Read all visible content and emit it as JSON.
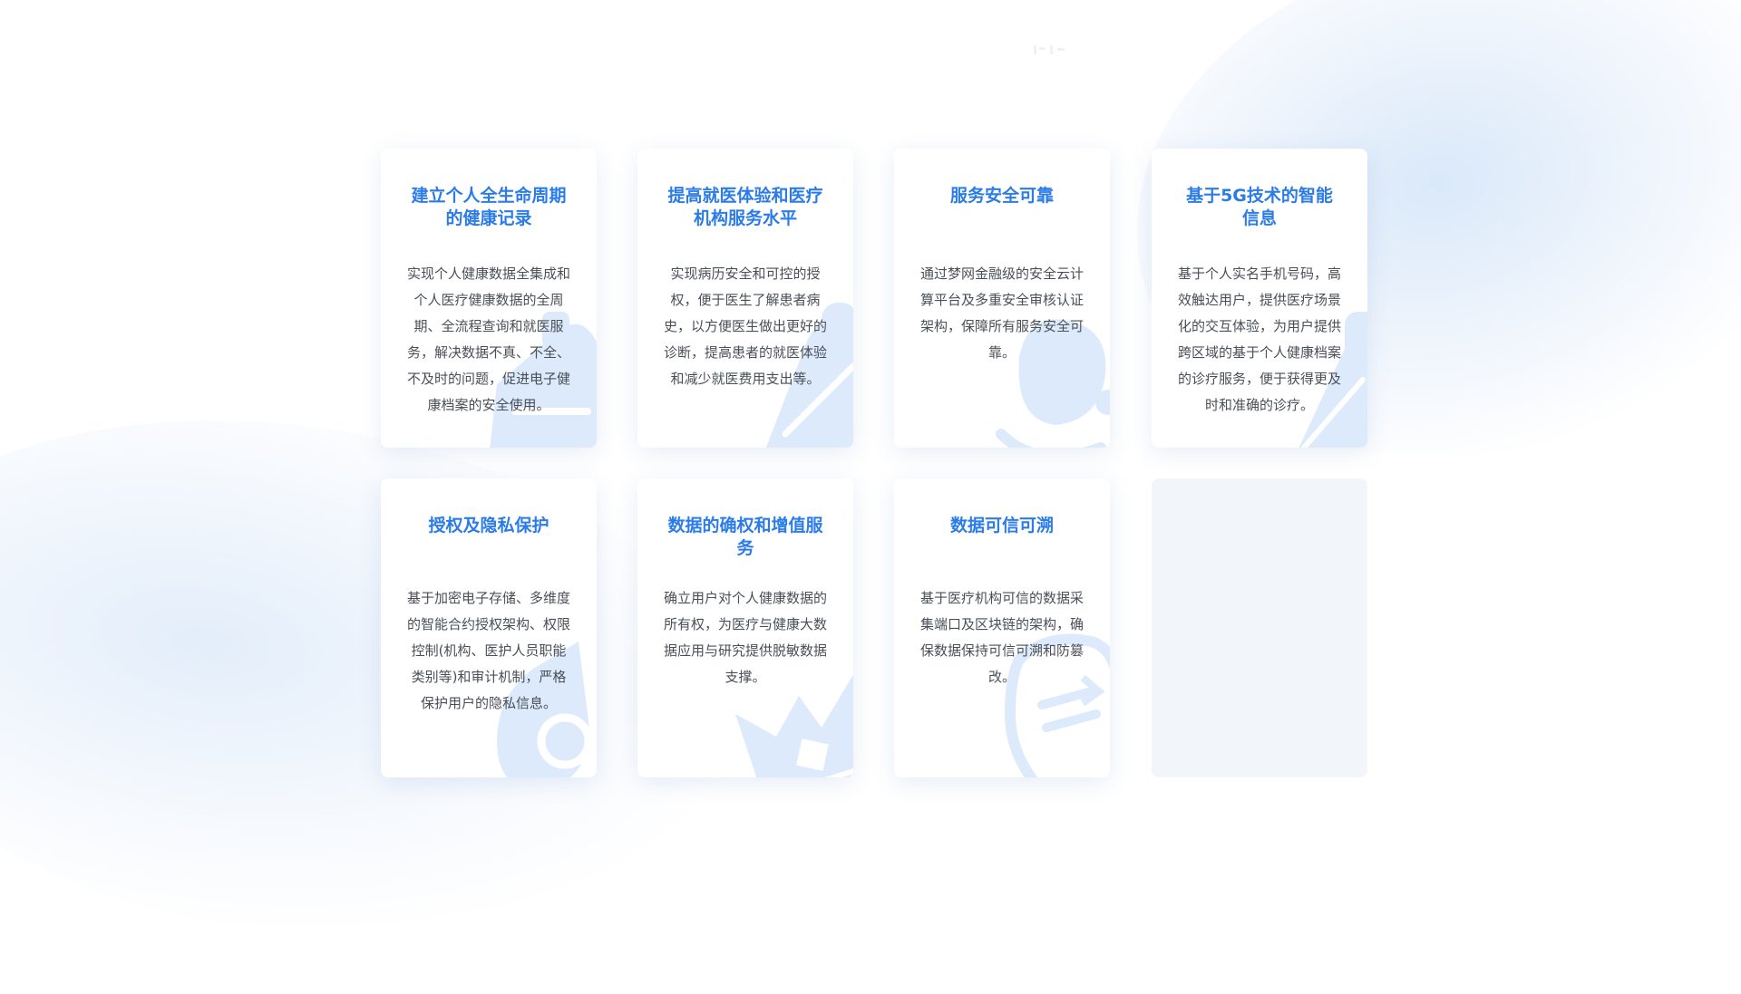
{
  "accent_color": "#2b7ce9",
  "illustration_color": "#d6e7fb",
  "features": [
    {
      "title": "建立个人全生命周期的健康记录",
      "description": "实现个人健康数据全集成和个人医疗健康数据的全周期、全流程查询和就医服务，解决数据不真、不全、不及时的问题，促进电子健康档案的安全使用。",
      "illustration": "medical-bag-icon"
    },
    {
      "title": "提高就医体验和医疗机构服务水平",
      "description": "实现病历安全和可控的授权，便于医生了解患者病史，以方便医生做出更好的诊断，提高患者的就医体验和减少就医费用支出等。",
      "illustration": "handshake-icon"
    },
    {
      "title": "服务安全可靠",
      "description": "通过梦网金融级的安全云计算平台及多重安全审核认证架构，保障所有服务安全可靠。",
      "illustration": "stethoscope-icon"
    },
    {
      "title": "基于5G技术的智能信息",
      "description": "基于个人实名手机号码，高效触达用户，提供医疗场景化的交互体验，为用户提供跨区域的基于个人健康档案的诊疗服务，便于获得更及时和准确的诊疗。",
      "illustration": "mobile-phone-icon"
    },
    {
      "title": "授权及隐私保护",
      "description": "基于加密电子存储、多维度的智能合约授权架构、权限控制(机构、医护人员职能类别等)和审计机制，严格保护用户的隐私信息。",
      "illustration": "security-lock-icon"
    },
    {
      "title": "数据的确权和增值服务",
      "description": "确立用户对个人健康数据的所有权，为医疗与健康大数据应用与研究提供脱敏数据支撑。",
      "illustration": "crown-icon"
    },
    {
      "title": "数据可信可溯",
      "description": "基于医疗机构可信的数据采集端口及区块链的架构，确保数据保持可信可溯和防篡改。",
      "illustration": "data-exchange-icon"
    }
  ]
}
